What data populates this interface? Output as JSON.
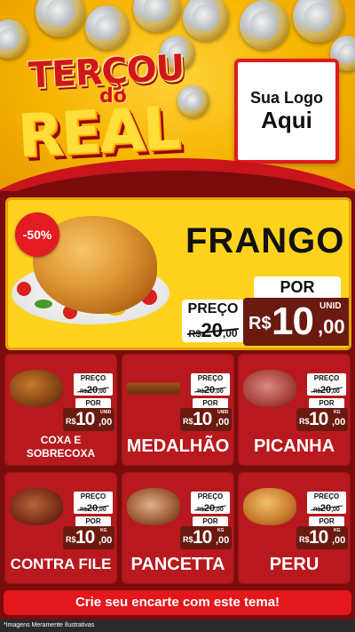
{
  "header": {
    "title_top": "TERÇOU",
    "title_mid": "do",
    "title_main": "REAL",
    "logo_line1": "Sua Logo",
    "logo_line2": "Aqui"
  },
  "hero": {
    "badge": "-50%",
    "name": "FRANGO",
    "preco_label": "PREÇO",
    "por_label": "POR",
    "old_currency": "R$",
    "old_whole": "20",
    "old_cents": ",00",
    "new_currency": "R$",
    "new_whole": "10",
    "new_cents": ",00",
    "unit": "UNID"
  },
  "products": [
    {
      "name": "COXA E SOBRECOXA",
      "preco_label": "PREÇO",
      "por_label": "POR",
      "old_currency": "R$",
      "old_whole": "20",
      "old_cents": ",00",
      "new_currency": "R$",
      "new_whole": "10",
      "new_cents": ",00",
      "unit": "UNID"
    },
    {
      "name": "MEDALHÃO",
      "preco_label": "PREÇO",
      "por_label": "POR",
      "old_currency": "R$",
      "old_whole": "20",
      "old_cents": ",00",
      "new_currency": "R$",
      "new_whole": "10",
      "new_cents": ",00",
      "unit": "UNID"
    },
    {
      "name": "PICANHA",
      "preco_label": "PREÇO",
      "por_label": "POR",
      "old_currency": "R$",
      "old_whole": "20",
      "old_cents": ",00",
      "new_currency": "R$",
      "new_whole": "10",
      "new_cents": ",00",
      "unit": "KG"
    },
    {
      "name": "CONTRA FILE",
      "preco_label": "PREÇO",
      "por_label": "POR",
      "old_currency": "R$",
      "old_whole": "20",
      "old_cents": ",00",
      "new_currency": "R$",
      "new_whole": "10",
      "new_cents": ",00",
      "unit": "KG"
    },
    {
      "name": "PANCETTA",
      "preco_label": "PREÇO",
      "por_label": "POR",
      "old_currency": "R$",
      "old_whole": "20",
      "old_cents": ",00",
      "new_currency": "R$",
      "new_whole": "10",
      "new_cents": ",00",
      "unit": "KG"
    },
    {
      "name": "PERU",
      "preco_label": "PREÇO",
      "por_label": "POR",
      "old_currency": "R$",
      "old_whole": "20",
      "old_cents": ",00",
      "new_currency": "R$",
      "new_whole": "10",
      "new_cents": ",00",
      "unit": "KG"
    }
  ],
  "cta": "Crie seu encarte com este tema!",
  "disclaimer": "*Imagens Meramente Ilustrativas",
  "colors": {
    "header_yellow": "#f6b400",
    "brand_red": "#e3171c",
    "card_red": "#b7191e",
    "price_brown": "#6b1a10",
    "background_dark_red": "#7a0c0c"
  }
}
